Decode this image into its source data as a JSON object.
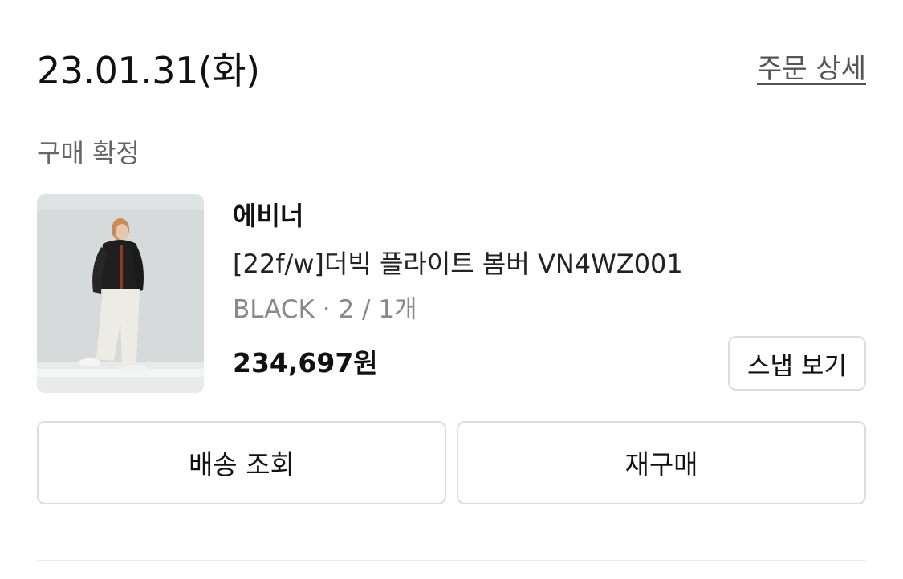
{
  "order": {
    "date": "23.01.31(화)",
    "detail_link": "주문 상세",
    "status": "구매 확정"
  },
  "product": {
    "brand": "에비너",
    "name": "[22f/w]더빅 플라이트 봄버 VN4WZ001",
    "option": "BLACK · 2 / 1개",
    "price": "234,697원",
    "snap_label": "스냅 보기"
  },
  "actions": {
    "track_label": "배송 조회",
    "rebuy_label": "재구매"
  },
  "colors": {
    "text_primary": "#111111",
    "text_secondary": "#666666",
    "text_muted": "#888888",
    "border": "#dcdcdc",
    "thumb_bg": "#eef0f0"
  }
}
